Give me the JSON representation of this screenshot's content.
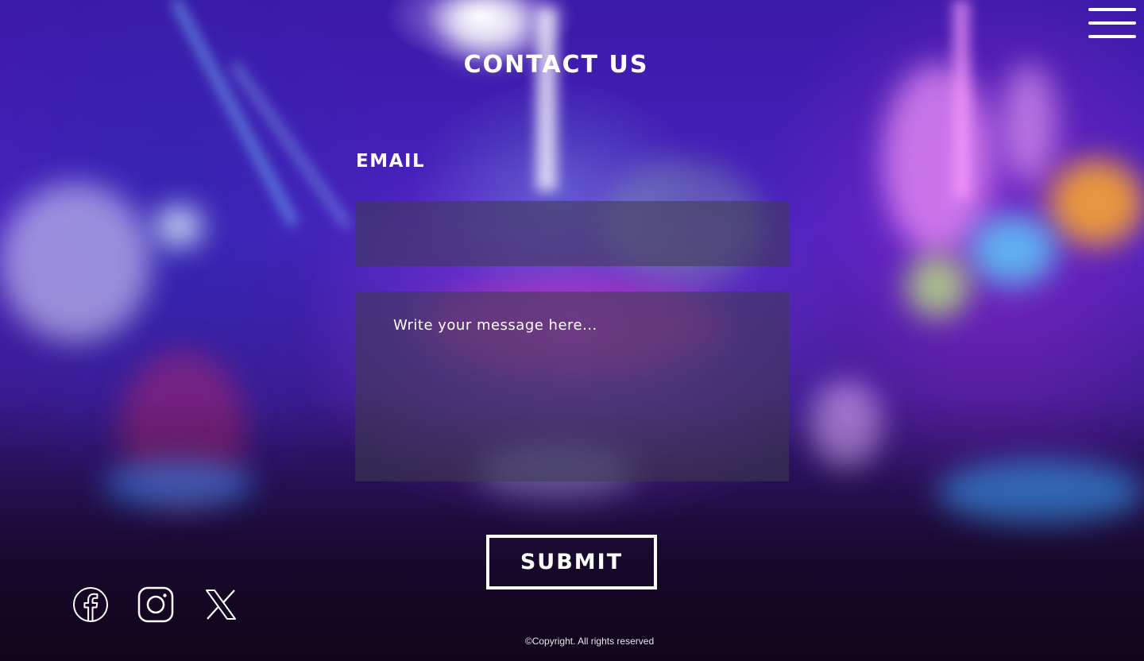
{
  "page": {
    "title": "CONTACT US"
  },
  "menu": {
    "icon": "hamburger-menu-icon"
  },
  "form": {
    "email_label": "EMAIL",
    "email_value": "",
    "email_placeholder": "",
    "message_value": "",
    "message_placeholder": "Write your message here...",
    "submit_label": "SUBMIT"
  },
  "social": [
    {
      "icon": "facebook-icon"
    },
    {
      "icon": "instagram-icon"
    },
    {
      "icon": "x-icon"
    }
  ],
  "footer": {
    "copyright": "©Copyright. All rights reserved"
  },
  "colors": {
    "text": "#ffffff",
    "field_background": "#3c3c4b",
    "background_accent": "#4a22c0"
  }
}
